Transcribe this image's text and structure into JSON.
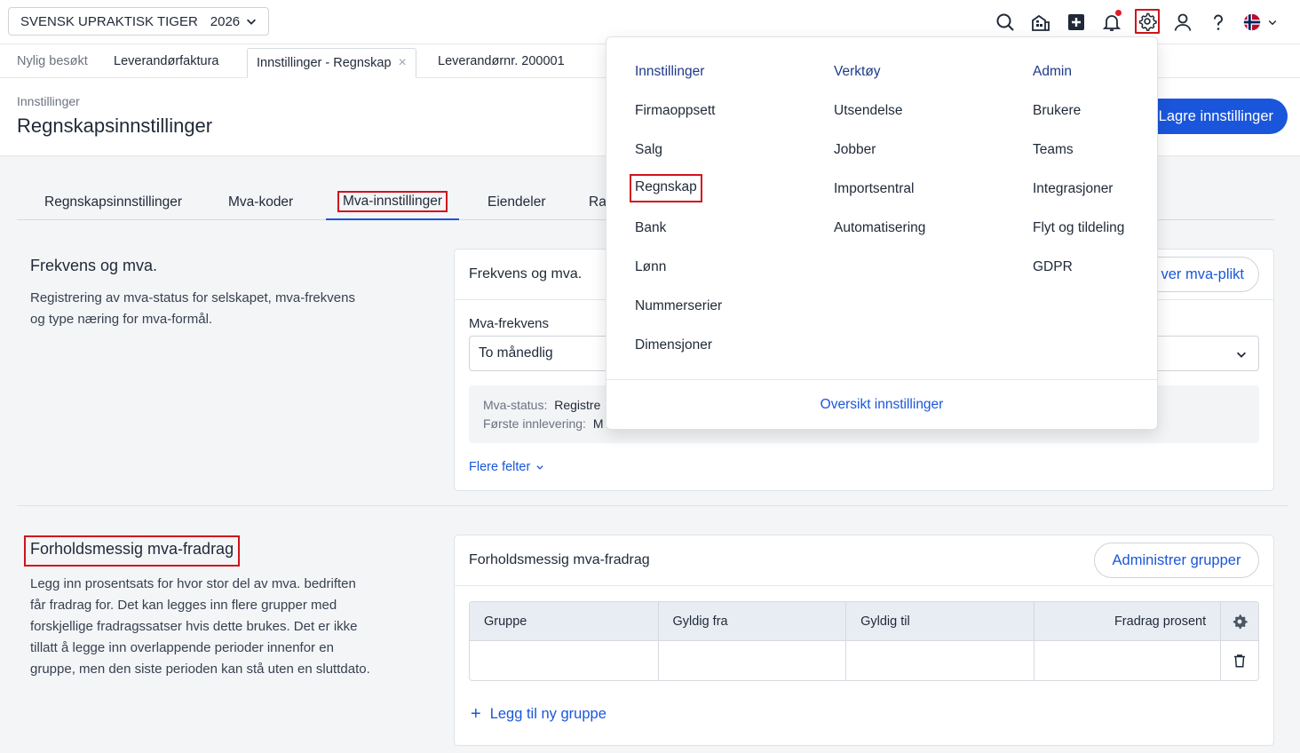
{
  "topbar": {
    "company": "SVENSK UPRAKTISK TIGER",
    "year": "2026",
    "icons": [
      "search-icon",
      "house-icon",
      "plus-square-icon",
      "bell-icon",
      "gear-icon",
      "user-icon",
      "help-icon",
      "flag-icon"
    ]
  },
  "tabs": {
    "recent_label": "Nylig besøkt",
    "items": [
      {
        "label": "Leverandørfaktura"
      },
      {
        "label": "Innstillinger - Regnskap"
      },
      {
        "label": "Leverandørnr. 200001"
      }
    ]
  },
  "page": {
    "breadcrumb": "Innstillinger",
    "title": "Regnskapsinnstillinger",
    "save_label": "Lagre innstillinger"
  },
  "subtabs": [
    {
      "label": "Regnskapsinnstillinger"
    },
    {
      "label": "Mva-koder"
    },
    {
      "label": "Mva-innstillinger"
    },
    {
      "label": "Eiendeler"
    },
    {
      "label": "Ra"
    }
  ],
  "section1": {
    "title": "Frekvens og mva.",
    "description_line1": "Registrering av mva-status for selskapet, mva-frekvens",
    "description_line2": "og type næring for mva-formål.",
    "card_title": "Frekvens og mva.",
    "card_button": "ver mva-plikt",
    "field_label": "Mva-frekvens",
    "field_value": "To månedlig",
    "status_label": "Mva-status:",
    "status_value": "Registre",
    "first_label": "Første innlevering:",
    "first_value": "M",
    "more_fields": "Flere felter"
  },
  "section2": {
    "title": "Forholdsmessig mva-fradrag",
    "desc_lines": [
      "Legg inn prosentsats for hvor stor del av mva. bedriften",
      "får fradrag for. Det kan legges inn flere grupper med",
      "forskjellige fradragssatser hvis dette brukes. Det er ikke",
      "tillatt å legge inn overlappende perioder innenfor en",
      "gruppe, men den siste perioden kan stå uten en sluttdato."
    ],
    "card_title": "Forholdsmessig mva-fradrag",
    "card_button": "Administrer grupper",
    "columns": [
      "Gruppe",
      "Gyldig fra",
      "Gyldig til",
      "Fradrag prosent"
    ],
    "add_label": "Legg til ny gruppe"
  },
  "menu": {
    "col1": {
      "head": "Innstillinger",
      "items": [
        "Firmaoppsett",
        "Salg",
        "Regnskap",
        "Bank",
        "Lønn",
        "Nummerserier",
        "Dimensjoner"
      ]
    },
    "col2": {
      "head": "Verktøy",
      "items": [
        "Utsendelse",
        "Jobber",
        "Importsentral",
        "Automatisering"
      ]
    },
    "col3": {
      "head": "Admin",
      "items": [
        "Brukere",
        "Teams",
        "Integrasjoner",
        "Flyt og tildeling",
        "GDPR"
      ]
    },
    "footer": "Oversikt innstillinger"
  },
  "colors": {
    "accent": "#1a56db",
    "highlight": "#d1131c"
  }
}
